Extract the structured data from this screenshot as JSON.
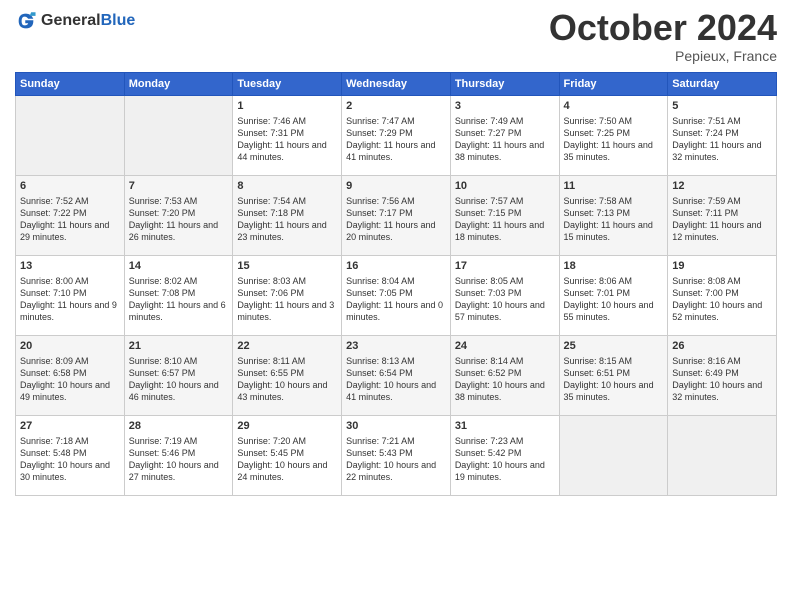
{
  "header": {
    "logo_general": "General",
    "logo_blue": "Blue",
    "month_title": "October 2024",
    "location": "Pepieux, France"
  },
  "days_of_week": [
    "Sunday",
    "Monday",
    "Tuesday",
    "Wednesday",
    "Thursday",
    "Friday",
    "Saturday"
  ],
  "weeks": [
    [
      {
        "day": "",
        "sunrise": "",
        "sunset": "",
        "daylight": ""
      },
      {
        "day": "",
        "sunrise": "",
        "sunset": "",
        "daylight": ""
      },
      {
        "day": "1",
        "sunrise": "Sunrise: 7:46 AM",
        "sunset": "Sunset: 7:31 PM",
        "daylight": "Daylight: 11 hours and 44 minutes."
      },
      {
        "day": "2",
        "sunrise": "Sunrise: 7:47 AM",
        "sunset": "Sunset: 7:29 PM",
        "daylight": "Daylight: 11 hours and 41 minutes."
      },
      {
        "day": "3",
        "sunrise": "Sunrise: 7:49 AM",
        "sunset": "Sunset: 7:27 PM",
        "daylight": "Daylight: 11 hours and 38 minutes."
      },
      {
        "day": "4",
        "sunrise": "Sunrise: 7:50 AM",
        "sunset": "Sunset: 7:25 PM",
        "daylight": "Daylight: 11 hours and 35 minutes."
      },
      {
        "day": "5",
        "sunrise": "Sunrise: 7:51 AM",
        "sunset": "Sunset: 7:24 PM",
        "daylight": "Daylight: 11 hours and 32 minutes."
      }
    ],
    [
      {
        "day": "6",
        "sunrise": "Sunrise: 7:52 AM",
        "sunset": "Sunset: 7:22 PM",
        "daylight": "Daylight: 11 hours and 29 minutes."
      },
      {
        "day": "7",
        "sunrise": "Sunrise: 7:53 AM",
        "sunset": "Sunset: 7:20 PM",
        "daylight": "Daylight: 11 hours and 26 minutes."
      },
      {
        "day": "8",
        "sunrise": "Sunrise: 7:54 AM",
        "sunset": "Sunset: 7:18 PM",
        "daylight": "Daylight: 11 hours and 23 minutes."
      },
      {
        "day": "9",
        "sunrise": "Sunrise: 7:56 AM",
        "sunset": "Sunset: 7:17 PM",
        "daylight": "Daylight: 11 hours and 20 minutes."
      },
      {
        "day": "10",
        "sunrise": "Sunrise: 7:57 AM",
        "sunset": "Sunset: 7:15 PM",
        "daylight": "Daylight: 11 hours and 18 minutes."
      },
      {
        "day": "11",
        "sunrise": "Sunrise: 7:58 AM",
        "sunset": "Sunset: 7:13 PM",
        "daylight": "Daylight: 11 hours and 15 minutes."
      },
      {
        "day": "12",
        "sunrise": "Sunrise: 7:59 AM",
        "sunset": "Sunset: 7:11 PM",
        "daylight": "Daylight: 11 hours and 12 minutes."
      }
    ],
    [
      {
        "day": "13",
        "sunrise": "Sunrise: 8:00 AM",
        "sunset": "Sunset: 7:10 PM",
        "daylight": "Daylight: 11 hours and 9 minutes."
      },
      {
        "day": "14",
        "sunrise": "Sunrise: 8:02 AM",
        "sunset": "Sunset: 7:08 PM",
        "daylight": "Daylight: 11 hours and 6 minutes."
      },
      {
        "day": "15",
        "sunrise": "Sunrise: 8:03 AM",
        "sunset": "Sunset: 7:06 PM",
        "daylight": "Daylight: 11 hours and 3 minutes."
      },
      {
        "day": "16",
        "sunrise": "Sunrise: 8:04 AM",
        "sunset": "Sunset: 7:05 PM",
        "daylight": "Daylight: 11 hours and 0 minutes."
      },
      {
        "day": "17",
        "sunrise": "Sunrise: 8:05 AM",
        "sunset": "Sunset: 7:03 PM",
        "daylight": "Daylight: 10 hours and 57 minutes."
      },
      {
        "day": "18",
        "sunrise": "Sunrise: 8:06 AM",
        "sunset": "Sunset: 7:01 PM",
        "daylight": "Daylight: 10 hours and 55 minutes."
      },
      {
        "day": "19",
        "sunrise": "Sunrise: 8:08 AM",
        "sunset": "Sunset: 7:00 PM",
        "daylight": "Daylight: 10 hours and 52 minutes."
      }
    ],
    [
      {
        "day": "20",
        "sunrise": "Sunrise: 8:09 AM",
        "sunset": "Sunset: 6:58 PM",
        "daylight": "Daylight: 10 hours and 49 minutes."
      },
      {
        "day": "21",
        "sunrise": "Sunrise: 8:10 AM",
        "sunset": "Sunset: 6:57 PM",
        "daylight": "Daylight: 10 hours and 46 minutes."
      },
      {
        "day": "22",
        "sunrise": "Sunrise: 8:11 AM",
        "sunset": "Sunset: 6:55 PM",
        "daylight": "Daylight: 10 hours and 43 minutes."
      },
      {
        "day": "23",
        "sunrise": "Sunrise: 8:13 AM",
        "sunset": "Sunset: 6:54 PM",
        "daylight": "Daylight: 10 hours and 41 minutes."
      },
      {
        "day": "24",
        "sunrise": "Sunrise: 8:14 AM",
        "sunset": "Sunset: 6:52 PM",
        "daylight": "Daylight: 10 hours and 38 minutes."
      },
      {
        "day": "25",
        "sunrise": "Sunrise: 8:15 AM",
        "sunset": "Sunset: 6:51 PM",
        "daylight": "Daylight: 10 hours and 35 minutes."
      },
      {
        "day": "26",
        "sunrise": "Sunrise: 8:16 AM",
        "sunset": "Sunset: 6:49 PM",
        "daylight": "Daylight: 10 hours and 32 minutes."
      }
    ],
    [
      {
        "day": "27",
        "sunrise": "Sunrise: 7:18 AM",
        "sunset": "Sunset: 5:48 PM",
        "daylight": "Daylight: 10 hours and 30 minutes."
      },
      {
        "day": "28",
        "sunrise": "Sunrise: 7:19 AM",
        "sunset": "Sunset: 5:46 PM",
        "daylight": "Daylight: 10 hours and 27 minutes."
      },
      {
        "day": "29",
        "sunrise": "Sunrise: 7:20 AM",
        "sunset": "Sunset: 5:45 PM",
        "daylight": "Daylight: 10 hours and 24 minutes."
      },
      {
        "day": "30",
        "sunrise": "Sunrise: 7:21 AM",
        "sunset": "Sunset: 5:43 PM",
        "daylight": "Daylight: 10 hours and 22 minutes."
      },
      {
        "day": "31",
        "sunrise": "Sunrise: 7:23 AM",
        "sunset": "Sunset: 5:42 PM",
        "daylight": "Daylight: 10 hours and 19 minutes."
      },
      {
        "day": "",
        "sunrise": "",
        "sunset": "",
        "daylight": ""
      },
      {
        "day": "",
        "sunrise": "",
        "sunset": "",
        "daylight": ""
      }
    ]
  ]
}
